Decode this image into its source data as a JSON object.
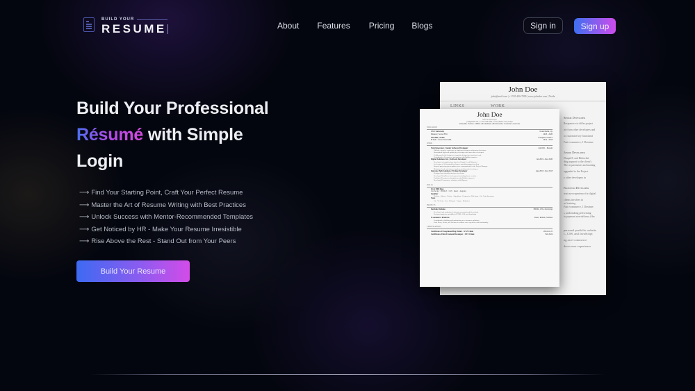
{
  "logo": {
    "small_text": "BUILD YOUR",
    "big_text": "RESUME",
    "icon": "resume-document-icon"
  },
  "nav": {
    "items": [
      {
        "label": "About"
      },
      {
        "label": "Features"
      },
      {
        "label": "Pricing"
      },
      {
        "label": "Blogs"
      }
    ],
    "signin_label": "Sign in",
    "signup_label": "Sign up"
  },
  "hero": {
    "title_line1": "Build Your Professional",
    "title_highlight": "Résumé",
    "title_line2_rest": " with Simple",
    "title_line3": "Login",
    "arrow_icon": "⟶",
    "features": [
      "Find Your Starting Point, Craft Your Perfect Resume",
      "Master the Art of Resume Writing with Best Practices",
      "Unlock Success with Mentor-Recommended Templates",
      "Get Noticed by HR - Make Your Resume Irresistible",
      "Rise Above the Rest - Stand Out from Your Peers"
    ],
    "cta_label": "Build Your Resume"
  },
  "colors": {
    "background": "#04060f",
    "gradient_start": "#3d6af2",
    "gradient_end": "#d34ce8"
  },
  "resume_back": {
    "name": "John Doe",
    "contact": "john@mail.com | +1 555-456-7890 | www.johndoe.com | Noida",
    "col_links": "LINKS",
    "col_work": "WORK",
    "side": [
      {
        "heading": "Senior Developer",
        "lines": [
          "Responsive to differ project",
          "ate from other developers and",
          "to customize key functional",
          "Fast ecommerce, 1 Dreamer"
        ]
      },
      {
        "heading": "Junior Developer",
        "lines": [
          "Drupal 8, and Bitbucket",
          "ding support to the client's",
          "The requirements and making",
          "upgraded to the Project",
          "y other developers in"
        ]
      },
      {
        "heading": "Frontend Developer",
        "lines": [
          "ient user experience for digital",
          "clients involves in",
          "ref training",
          "Fast ecommerce, 1 Dreamer",
          "s, undertaking performing",
          "to payment non-delivery files"
        ]
      },
      {
        "heading": "",
        "lines": [
          "personal portfolio website",
          "L, CSS, and JavaScript",
          "ng an e-commerce",
          "ducer user experience"
        ]
      }
    ]
  },
  "resume_front": {
    "name": "John Doe",
    "subtitle": "Software Developer",
    "contact": "john@mail.com | +1 555-456-7890 | www.johndoe.com | Noida",
    "links": "LinkedIn | Twitter | GitHub | HackerRank | Hackerearth | CodeChef | Leetcode",
    "education_heading": "Education",
    "education": [
      {
        "school": "XYZ University",
        "place": "Noida/Delhi, Up",
        "detail": "Masters | Score: 80%",
        "date": "2018 - 2020"
      },
      {
        "school": "NSSABC, Noida",
        "place": "Computer Science",
        "detail": "B.Tech · Score: 8.0 CGPA",
        "date": "2014 - 2018"
      }
    ],
    "work_heading": "Work",
    "work": [
      {
        "title": "Tech Innovators | Senior Software Developer",
        "date": "Jan 2021 - Present",
        "bullets": [
          "Utilized extensive experience to implement features and mentor developers",
          "Streamlined high-code quality by reviewing code from other developers",
          "Collaborated with designers to translate designs into functional code",
          "Contributed to Ecommerce integrations with Bubblecommerce"
        ]
      },
      {
        "title": "Digital Solutions Ltd. | Software Developer",
        "date": "Jan 2019 - Dec 2020",
        "bullets": [
          "Developed web applications based on Drupal 8, and Bitbucket",
          "Led a team of 10 frontend developers, providing support to client",
          "Ensured project progress updates were communicated to the Project Manager",
          "Maintained code and features implemented by other developers"
        ]
      },
      {
        "title": "Innovate Tech Solutions | Trainee Developer",
        "date": "Aug 2018 - Dec 2018",
        "bullets": [
          "Designed user-friendly interfaces for clients",
          "Developed WordPress development including theme creation",
          "Facilitated Ecommerce integrations with Bubblecommerce",
          "Developed E-commerce solutions with Magento"
        ]
      }
    ],
    "skills_heading": "Skills",
    "skills": [
      {
        "label": "Over 5000 lines",
        "value": "JavaScript · HTML5 · CSS · React · Angular"
      },
      {
        "label": "Familiar",
        "value": "Firebase · jQuery · Redux · Algorithms · Progressive Web Apps · Git · Data Structures"
      },
      {
        "label": "Tools",
        "value": "Git · VS Code · Jira · Webpack · Figma · Bitbucket"
      }
    ],
    "projects_heading": "Projects",
    "projects": [
      {
        "title": "Portfolio Website",
        "tech": "HTML, CSS, JavaScript",
        "bullets": [
          "Developed and maintained a dynamic personal portfolio website",
          "Performed projects and skills in HTML, CSS, and JavaScript"
        ]
      },
      {
        "title": "E-commerce Platform",
        "tech": "React, Redux, Firebase",
        "bullets": [
          "Contributed to building and maintaining an e-commerce platform",
          "Used React, Redux, and Firebase to enhance user experience and functionality"
        ]
      }
    ],
    "certificates_heading": "Certifications",
    "certificates": [
      {
        "title": "Certificate of Exceptional Bug Finder - XYZ Client",
        "date": "2024-11-25"
      },
      {
        "title": "Certificate of Best Frontend Developer - XYZ Client",
        "date": "Feb 2024"
      }
    ]
  }
}
